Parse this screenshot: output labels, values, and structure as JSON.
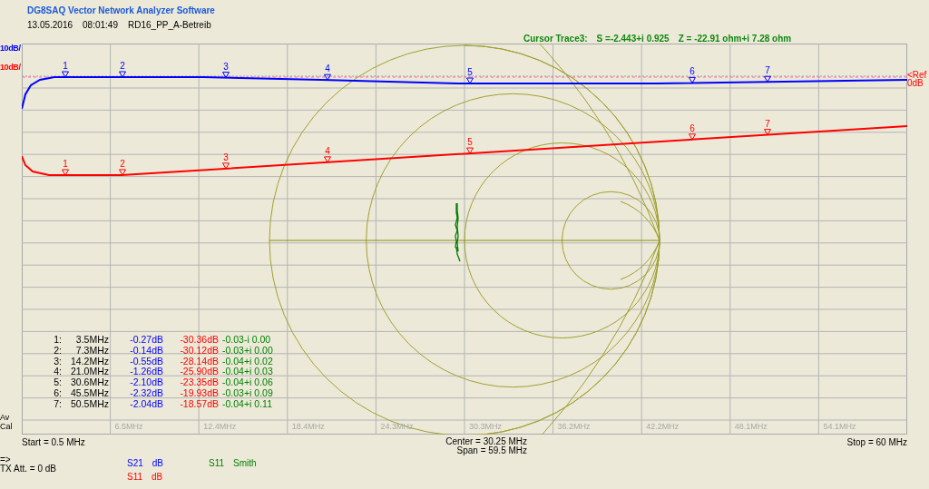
{
  "app_title": "DG8SAQ Vector Network Analyzer Software",
  "info": {
    "date": "13.05.2016",
    "time": "08:01:49",
    "file": "RD16_PP_A-Betreib"
  },
  "cursor_readout": {
    "label": "Cursor Trace3:",
    "s": "S =-2.443+i 0.925",
    "z": "Z = -22.91 ohm+i   7.28 ohm"
  },
  "scale_labels": [
    {
      "text": "10dB/",
      "color": "#0000ff"
    },
    {
      "text": "10dB/",
      "color": "#ff0000"
    }
  ],
  "ref_labels": [
    "<Ref",
    "0dB"
  ],
  "traces": [
    {
      "kind": "magnitude",
      "name": "S21",
      "format": "dB",
      "color": "#0000ff",
      "marker_labels": [
        "1",
        "2",
        "3",
        "4",
        "5",
        "6",
        "7"
      ]
    },
    {
      "kind": "magnitude",
      "name": "S11",
      "format": "dB",
      "color": "#ff0000",
      "marker_labels": [
        "1",
        "2",
        "3",
        "4",
        "5",
        "6",
        "7"
      ]
    },
    {
      "kind": "smith",
      "name": "S11",
      "format": "Smith",
      "color": "#008000"
    }
  ],
  "freq_labels": [
    "6.5MHz",
    "12.4MHz",
    "18.4MHz",
    "24.3MHz",
    "30.3MHz",
    "36.2MHz",
    "42.2MHz",
    "48.1MHz",
    "54.1MHz"
  ],
  "marker_table": [
    {
      "index": "1:",
      "freq": "3.5MHz",
      "s21": "-0.27dB",
      "s11": "-30.36dB",
      "smith": "-0.03-i 0.00"
    },
    {
      "index": "2:",
      "freq": "7.3MHz",
      "s21": "-0.14dB",
      "s11": "-30.12dB",
      "smith": "-0.03+i 0.00"
    },
    {
      "index": "3:",
      "freq": "14.2MHz",
      "s21": "-0.55dB",
      "s11": "-28.14dB",
      "smith": "-0.04+i 0.02"
    },
    {
      "index": "4:",
      "freq": "21.0MHz",
      "s21": "-1.26dB",
      "s11": "-25.90dB",
      "smith": "-0.04+i 0.03"
    },
    {
      "index": "5:",
      "freq": "30.6MHz",
      "s21": "-2.10dB",
      "s11": "-23.35dB",
      "smith": "-0.04+i 0.06"
    },
    {
      "index": "6:",
      "freq": "45.5MHz",
      "s21": "-2.32dB",
      "s11": "-19.93dB",
      "smith": "-0.03+i 0.09"
    },
    {
      "index": "7:",
      "freq": "50.5MHz",
      "s21": "-2.04dB",
      "s11": "-18.57dB",
      "smith": "-0.04+i 0.11"
    }
  ],
  "side_status": [
    "Av",
    "Cal"
  ],
  "sweep": {
    "start": "Start = 0.5 MHz",
    "center": "Center = 30.25 MHz",
    "span": "Span = 59.5 MHz",
    "stop": "Stop = 60 MHz"
  },
  "tx": {
    "arrow": "=>",
    "attenuation": "TX Att.  = 0 dB"
  }
}
